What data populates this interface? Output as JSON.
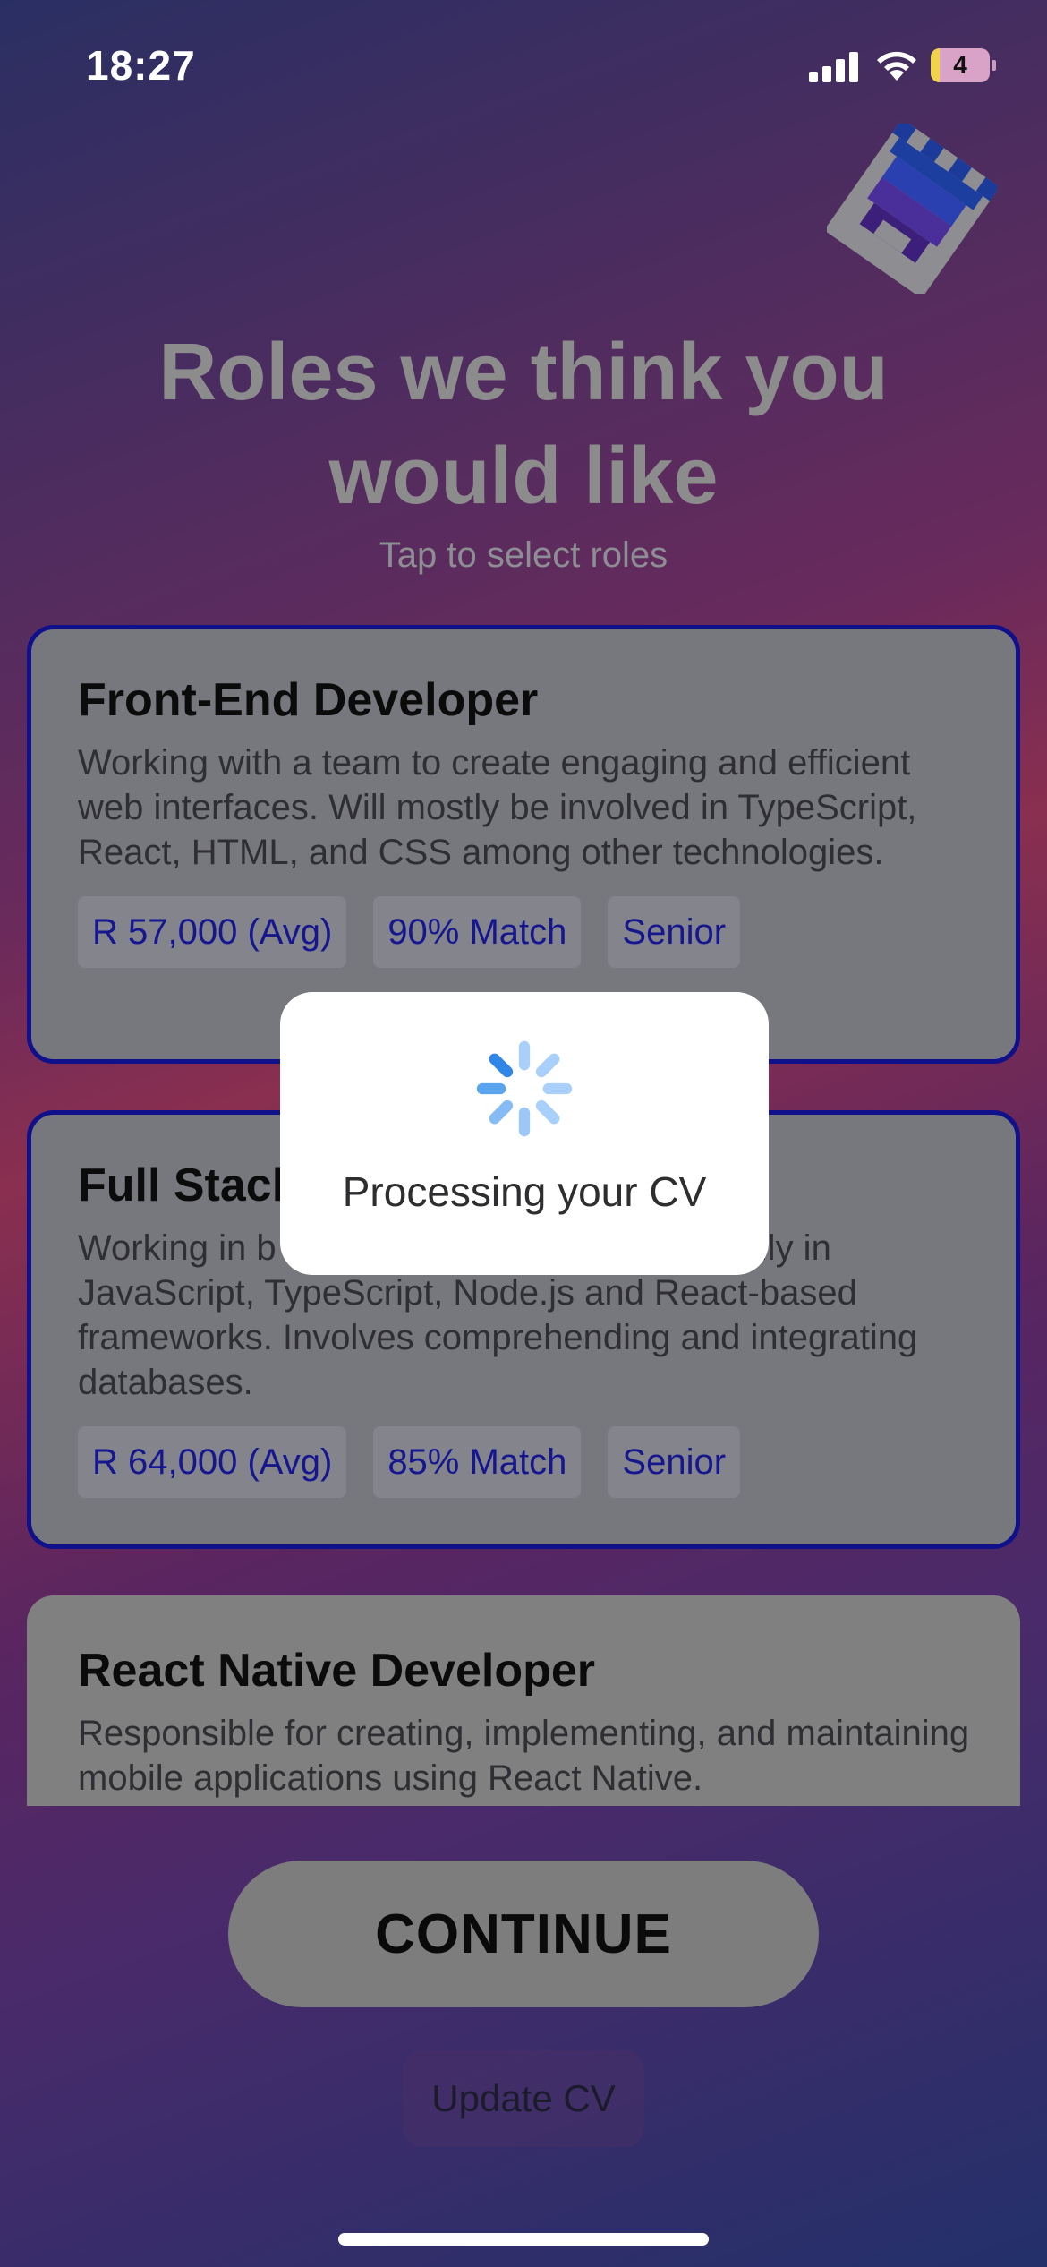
{
  "status_bar": {
    "time": "18:27",
    "battery": "4"
  },
  "header": {
    "title": "Roles we think you would like",
    "subtitle": "Tap to select roles"
  },
  "roles": [
    {
      "title": "Front-End Developer",
      "description": "Working with a team to create engaging and efficient web interfaces. Will mostly be involved in TypeScript, React, HTML, and CSS among other technologies.",
      "salary": "R 57,000 (Avg)",
      "match": "90% Match",
      "level": "Senior",
      "selected": true
    },
    {
      "title": "Full Stack",
      "description": "Working in b                          lopment, usually in JavaScript, TypeScript, Node.js and React-based frameworks. Involves comprehending and integrating databases.",
      "salary": "R 64,000 (Avg)",
      "match": "85% Match",
      "level": "Senior",
      "selected": true
    },
    {
      "title": "React Native Developer",
      "description": "Responsible for creating, implementing, and maintaining mobile applications using React Native.",
      "selected": false
    }
  ],
  "actions": {
    "continue_label": "CONTINUE",
    "update_cv_label": "Update CV"
  },
  "modal": {
    "text": "Processing your CV"
  },
  "colors": {
    "card_border": "#10108a",
    "chip_text": "#16168f",
    "spinner": "#6fb0f0"
  }
}
